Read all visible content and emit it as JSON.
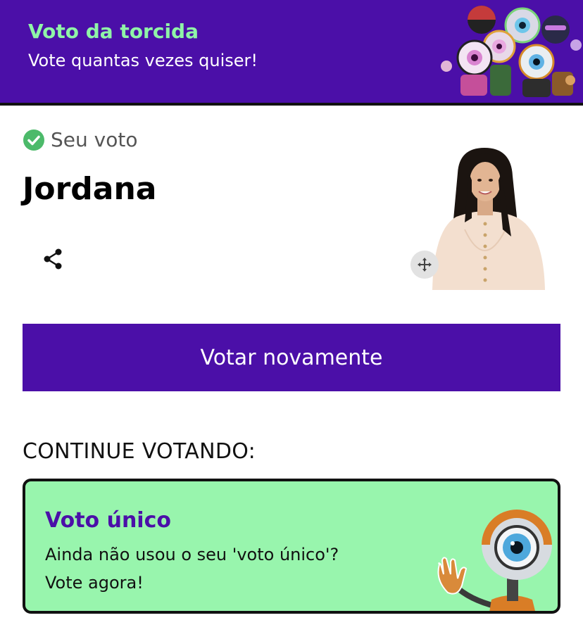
{
  "header": {
    "title": "Voto da torcida",
    "subtitle": "Vote quantas vezes quiser!"
  },
  "vote": {
    "status_label": "Seu voto",
    "candidate": "Jordana"
  },
  "actions": {
    "vote_again_label": "Votar novamente"
  },
  "continue_section": {
    "heading": "CONTINUE VOTANDO:"
  },
  "single_vote_card": {
    "title": "Voto único",
    "line1": "Ainda não usou o seu 'voto único'?",
    "line2": "Vote agora!"
  },
  "colors": {
    "brand_purple": "#4b0fa8",
    "accent_green": "#8ff5a7",
    "card_green": "#98f5ad",
    "check_green": "#4cba6a"
  },
  "icons": [
    "check-circle-icon",
    "share-icon",
    "move-arrows-icon",
    "eye-robot-mascot"
  ]
}
